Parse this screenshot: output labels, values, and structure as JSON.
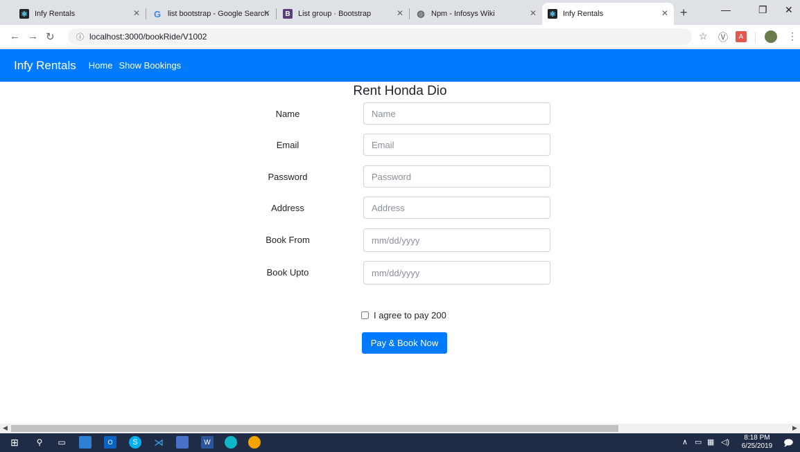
{
  "browser": {
    "tabs": [
      {
        "title": "Infy Rentals",
        "icon": "react-icon",
        "active": false
      },
      {
        "title": "list bootstrap - Google Search",
        "icon": "google-icon",
        "active": false
      },
      {
        "title": "List group · Bootstrap",
        "icon": "bootstrap-icon",
        "active": false
      },
      {
        "title": "Npm - Infosys Wiki",
        "icon": "globe-icon",
        "active": false
      },
      {
        "title": "Infy Rentals",
        "icon": "react-icon",
        "active": true
      }
    ],
    "url": "localhost:3000/bookRide/V1002"
  },
  "navbar": {
    "brand": "Infy Rentals",
    "links": [
      "Home",
      "Show Bookings"
    ],
    "color": "#007bff"
  },
  "form": {
    "title": "Rent Honda Dio",
    "fields": [
      {
        "label": "Name",
        "placeholder": "Name",
        "type": "text"
      },
      {
        "label": "Email",
        "placeholder": "Email",
        "type": "text"
      },
      {
        "label": "Password",
        "placeholder": "Password",
        "type": "text"
      },
      {
        "label": "Address",
        "placeholder": "Address",
        "type": "text"
      },
      {
        "label": "Book From",
        "placeholder": "mm/dd/yyyy",
        "type": "date"
      },
      {
        "label": "Book Upto",
        "placeholder": "mm/dd/yyyy",
        "type": "date"
      }
    ],
    "agree_label": "I agree to pay 200",
    "submit_label": "Pay & Book Now"
  },
  "taskbar": {
    "time": "8:18 PM",
    "date": "6/25/2019"
  }
}
